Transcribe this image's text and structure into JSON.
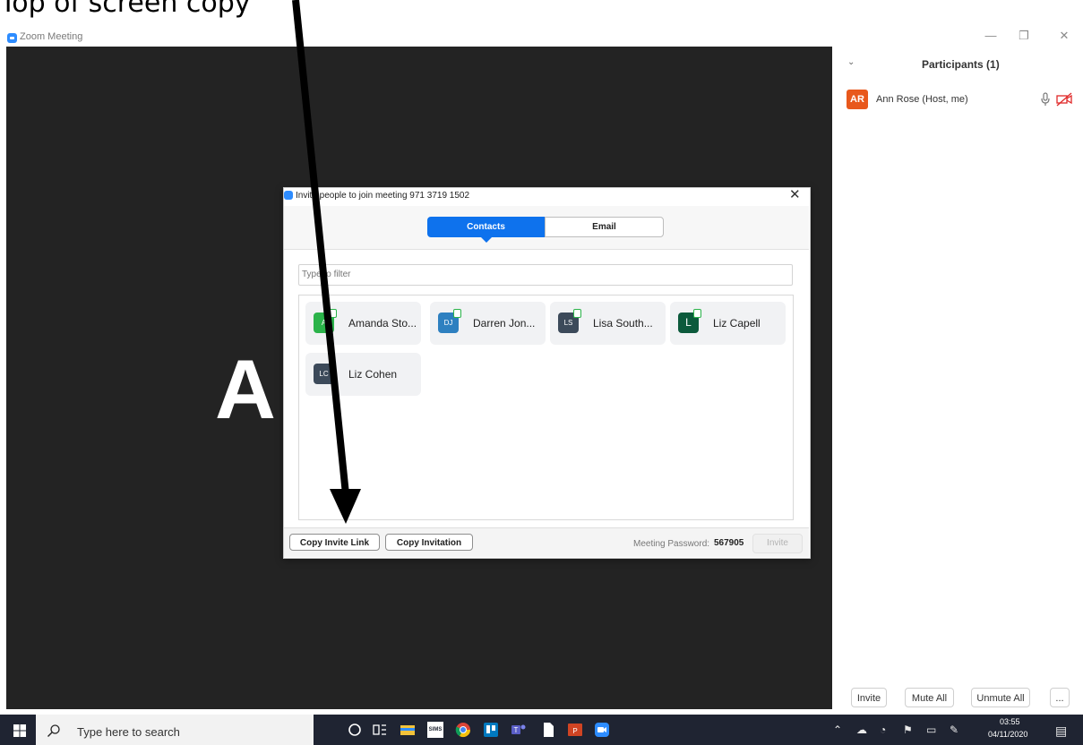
{
  "caption": "Top of screen copy",
  "window": {
    "title": "Zoom Meeting",
    "minimize": "—",
    "restore": "❐",
    "close": "✕"
  },
  "video": {
    "avatar_letter": "A"
  },
  "participants": {
    "title": "Participants (1)",
    "list": [
      {
        "initials": "AR",
        "name": "Ann Rose (Host, me)",
        "avatar_color": "#e8581c"
      }
    ],
    "buttons": {
      "invite": "Invite",
      "mute_all": "Mute All",
      "unmute_all": "Unmute All",
      "more": "..."
    }
  },
  "dialog": {
    "title": "Invite people to join meeting 971 3719 1502",
    "close": "✕",
    "tabs": {
      "contacts": "Contacts",
      "email": "Email",
      "active": "Contacts"
    },
    "filter_placeholder": "Type to filter",
    "contacts": [
      {
        "initials": "A",
        "name": "Amanda Sto...",
        "color": "#2bb34a"
      },
      {
        "initials": "DJ",
        "name": "Darren Jon...",
        "color": "#2e80c0"
      },
      {
        "initials": "LS",
        "name": "Lisa South...",
        "color": "#3c4a5a"
      },
      {
        "initials": "L",
        "name": "Liz Capell",
        "color": "#0c5a3c"
      },
      {
        "initials": "LC",
        "name": "Liz Cohen",
        "color": "#3c4a5a"
      }
    ],
    "copy_invite_link": "Copy Invite Link",
    "copy_invitation": "Copy Invitation",
    "password_label": "Meeting Password:",
    "password_value": "567905",
    "invite": "Invite"
  },
  "taskbar": {
    "search_placeholder": "Type here to search",
    "apps": [
      "cortana-icon",
      "task-view-icon",
      "file-explorer-icon",
      "sims-icon",
      "chrome-icon",
      "trello-icon",
      "teams-icon",
      "file-icon",
      "powerpoint-icon",
      "zoom-icon"
    ],
    "sims_label": "SIMS",
    "clock_time": "03:55",
    "clock_date": "04/11/2020",
    "colors": {
      "taskbar": "#1f2432",
      "zoom_blue": "#2d8cff",
      "contacts_tab": "#0e72ed"
    }
  }
}
